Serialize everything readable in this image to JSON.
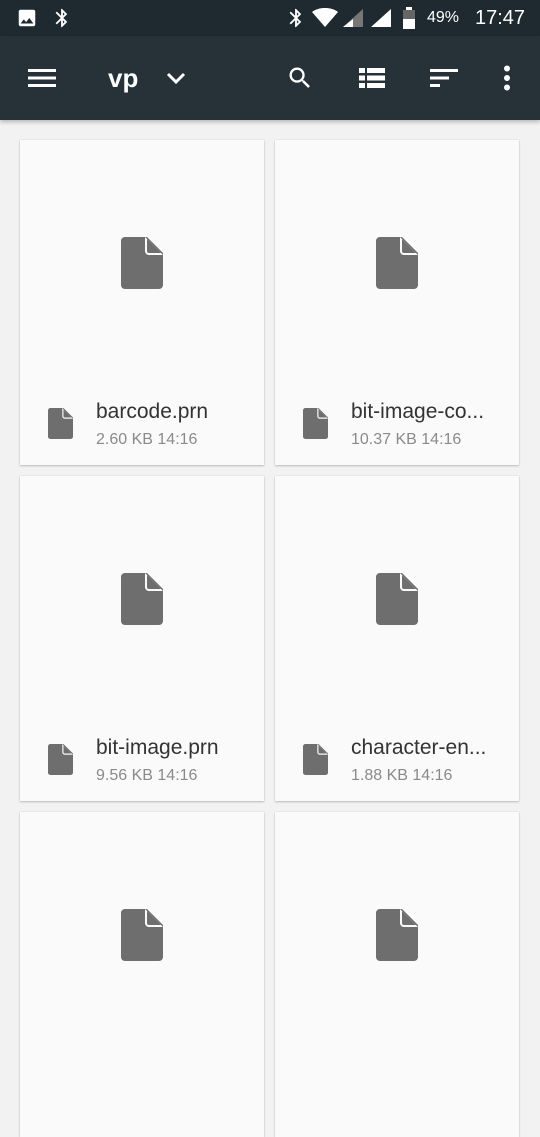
{
  "status_bar": {
    "battery": "49%",
    "time": "17:47",
    "icons": [
      "gallery-notification-icon",
      "bluetooth-icon",
      "wifi-icon",
      "signal-icon",
      "battery-icon"
    ]
  },
  "toolbar": {
    "title": "vp",
    "icons": [
      "menu-icon",
      "dropdown-chevron-icon",
      "search-icon",
      "list-view-icon",
      "sort-icon",
      "more-vert-icon"
    ]
  },
  "files": [
    {
      "name": "barcode.prn",
      "size": "2.60 KB",
      "time": "14:16"
    },
    {
      "name": "bit-image-co...",
      "size": "10.37 KB",
      "time": "14:16"
    },
    {
      "name": "bit-image.prn",
      "size": "9.56 KB",
      "time": "14:16"
    },
    {
      "name": "character-en...",
      "size": "1.88 KB",
      "time": "14:16"
    },
    {
      "name": "",
      "size": "",
      "time": ""
    },
    {
      "name": "",
      "size": "",
      "time": ""
    }
  ]
}
